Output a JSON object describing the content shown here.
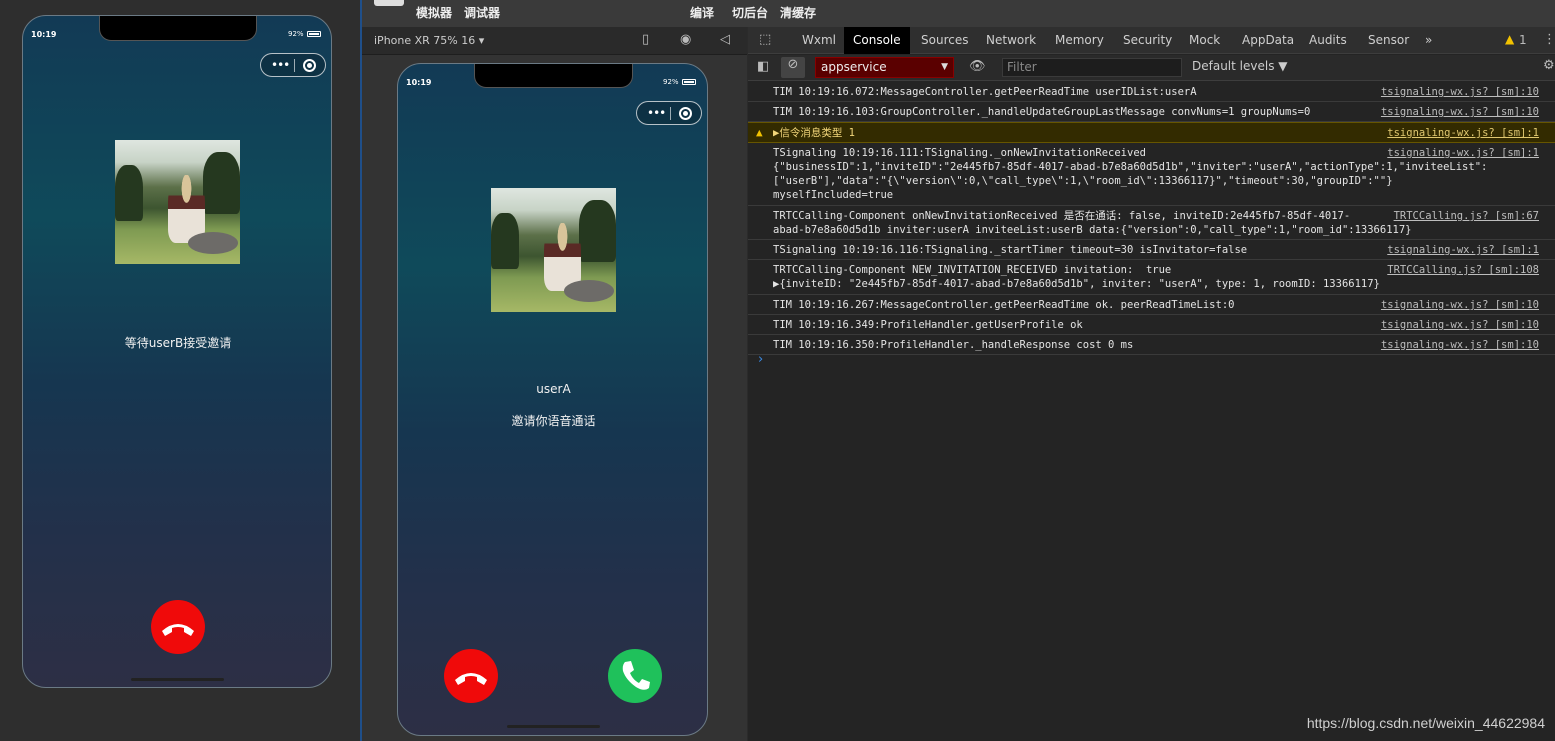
{
  "topbar": {
    "simulator": "模拟器",
    "debugger": "调试器",
    "compile": "编译",
    "background": "切后台",
    "clear_cache": "清缓存"
  },
  "device": {
    "label": "iPhone XR 75% 16 ▾"
  },
  "phone_left": {
    "time": "10:19",
    "battery": "92%",
    "waiting": "等待userB接受邀请"
  },
  "phone_mid": {
    "time": "10:19",
    "battery": "92%",
    "caller": "userA",
    "invite_text": "邀请你语音通话"
  },
  "devtools": {
    "tabs": [
      "Wxml",
      "Console",
      "Sources",
      "Network",
      "Memory",
      "Security",
      "Mock",
      "AppData",
      "Audits",
      "Sensor"
    ],
    "active_tab": "Console",
    "more": "»",
    "warn_count": "1",
    "context": "appservice",
    "filter_placeholder": "Filter",
    "levels": "Default levels ▼",
    "logs": [
      {
        "text": "TIM 10:19:16.072:MessageController.getPeerReadTime userIDList:userA",
        "src": "tsignaling-wx.js? [sm]:10",
        "type": "log"
      },
      {
        "text": "TIM 10:19:16.103:GroupController._handleUpdateGroupLastMessage convNums=1 groupNums=0",
        "src": "tsignaling-wx.js? [sm]:10",
        "type": "log"
      },
      {
        "text": "▶信令消息类型 1",
        "src": "tsignaling-wx.js? [sm]:1",
        "type": "warn"
      },
      {
        "text": "TSignaling 10:19:16.111:TSignaling._onNewInvitationReceived\n{\"businessID\":1,\"inviteID\":\"2e445fb7-85df-4017-abad-b7e8a60d5d1b\",\"inviter\":\"userA\",\"actionType\":1,\"inviteeList\":\n[\"userB\"],\"data\":\"{\\\"version\\\":0,\\\"call_type\\\":1,\\\"room_id\\\":13366117}\",\"timeout\":30,\"groupID\":\"\"}\nmyselfIncluded=true",
        "src": "tsignaling-wx.js? [sm]:1",
        "type": "log"
      },
      {
        "text": "TRTCCalling-Component onNewInvitationReceived 是否在通话: false, inviteID:2e445fb7-85df-4017-\nabad-b7e8a60d5d1b inviter:userA inviteeList:userB data:{\"version\":0,\"call_type\":1,\"room_id\":13366117}",
        "src": "TRTCCalling.js? [sm]:67",
        "type": "log"
      },
      {
        "text": "TSignaling 10:19:16.116:TSignaling._startTimer timeout=30 isInvitator=false",
        "src": "tsignaling-wx.js? [sm]:1",
        "type": "log"
      },
      {
        "text": "TRTCCalling-Component NEW_INVITATION_RECEIVED invitation:  true\n▶{inviteID: \"2e445fb7-85df-4017-abad-b7e8a60d5d1b\", inviter: \"userA\", type: 1, roomID: 13366117}",
        "src": "TRTCCalling.js? [sm]:108",
        "type": "log"
      },
      {
        "text": "TIM 10:19:16.267:MessageController.getPeerReadTime ok. peerReadTimeList:0",
        "src": "tsignaling-wx.js? [sm]:10",
        "type": "log"
      },
      {
        "text": "TIM 10:19:16.349:ProfileHandler.getUserProfile ok",
        "src": "tsignaling-wx.js? [sm]:10",
        "type": "log"
      },
      {
        "text": "TIM 10:19:16.350:ProfileHandler._handleResponse cost 0 ms",
        "src": "tsignaling-wx.js? [sm]:10",
        "type": "log"
      }
    ],
    "prompt": "›"
  },
  "watermark": "https://blog.csdn.net/weixin_44622984"
}
